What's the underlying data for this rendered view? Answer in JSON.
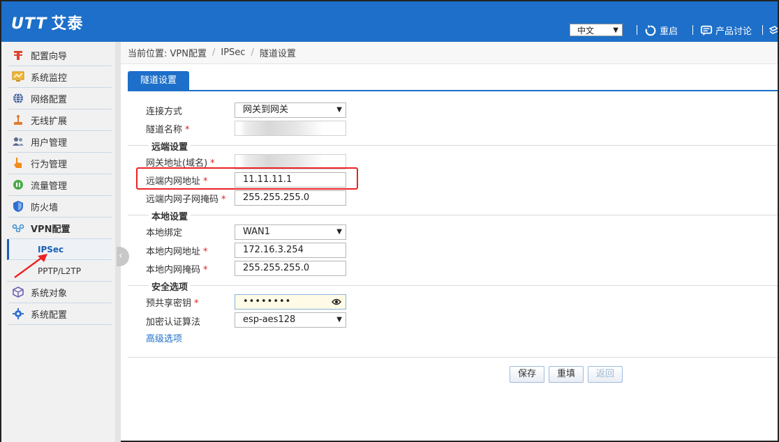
{
  "header": {
    "logo_mark": "UTT",
    "logo_text": "艾泰",
    "language": "中文",
    "restart_label": "重启",
    "discuss_label": "产品讨论"
  },
  "sidebar": {
    "items": [
      {
        "label": "配置向导",
        "icon": "wizard-icon",
        "color": "#e0432f"
      },
      {
        "label": "系统监控",
        "icon": "monitor-icon",
        "color": "#e6a21d"
      },
      {
        "label": "网络配置",
        "icon": "globe-icon",
        "color": "#2f4f8f"
      },
      {
        "label": "无线扩展",
        "icon": "wireless-icon",
        "color": "#e07b2f"
      },
      {
        "label": "用户管理",
        "icon": "users-icon",
        "color": "#5a6a8a"
      },
      {
        "label": "行为管理",
        "icon": "hand-icon",
        "color": "#f08c1a"
      },
      {
        "label": "流量管理",
        "icon": "traffic-icon",
        "color": "#4aaa4a"
      },
      {
        "label": "防火墙",
        "icon": "shield-icon",
        "color": "#2f6fd0"
      },
      {
        "label": "VPN配置",
        "icon": "vpn-icon",
        "color": "#3f8fd0"
      },
      {
        "label": "系统对象",
        "icon": "cube-icon",
        "color": "#6a5fb4"
      },
      {
        "label": "系统配置",
        "icon": "gear-icon",
        "color": "#2f6fd0"
      }
    ],
    "vpn_sub": [
      "IPSec",
      "PPTP/L2TP"
    ]
  },
  "breadcrumb": {
    "prefix": "当前位置: VPN配置",
    "level2": "IPSec",
    "level3": "隧道设置"
  },
  "tab": "隧道设置",
  "form": {
    "connection_type_label": "连接方式",
    "connection_type_value": "网关到网关",
    "tunnel_name_label": "隧道名称",
    "remote_section": "远端设置",
    "gateway_label": "网关地址(域名)",
    "remote_lan_label": "远端内网地址",
    "remote_lan_value": "11.11.11.1",
    "remote_mask_label": "远端内网子网掩码",
    "remote_mask_value": "255.255.255.0",
    "local_section": "本地设置",
    "local_bind_label": "本地绑定",
    "local_bind_value": "WAN1",
    "local_lan_label": "本地内网地址",
    "local_lan_value": "172.16.3.254",
    "local_mask_label": "本地内网掩码",
    "local_mask_value": "255.255.255.0",
    "security_section": "安全选项",
    "psk_label": "预共享密钥",
    "psk_value": "••••••••",
    "encrypt_label": "加密认证算法",
    "encrypt_value": "esp-aes128",
    "advanced_link": "高级选项",
    "required_mark": "*"
  },
  "buttons": {
    "save": "保存",
    "reset": "重填",
    "back": "返回"
  }
}
